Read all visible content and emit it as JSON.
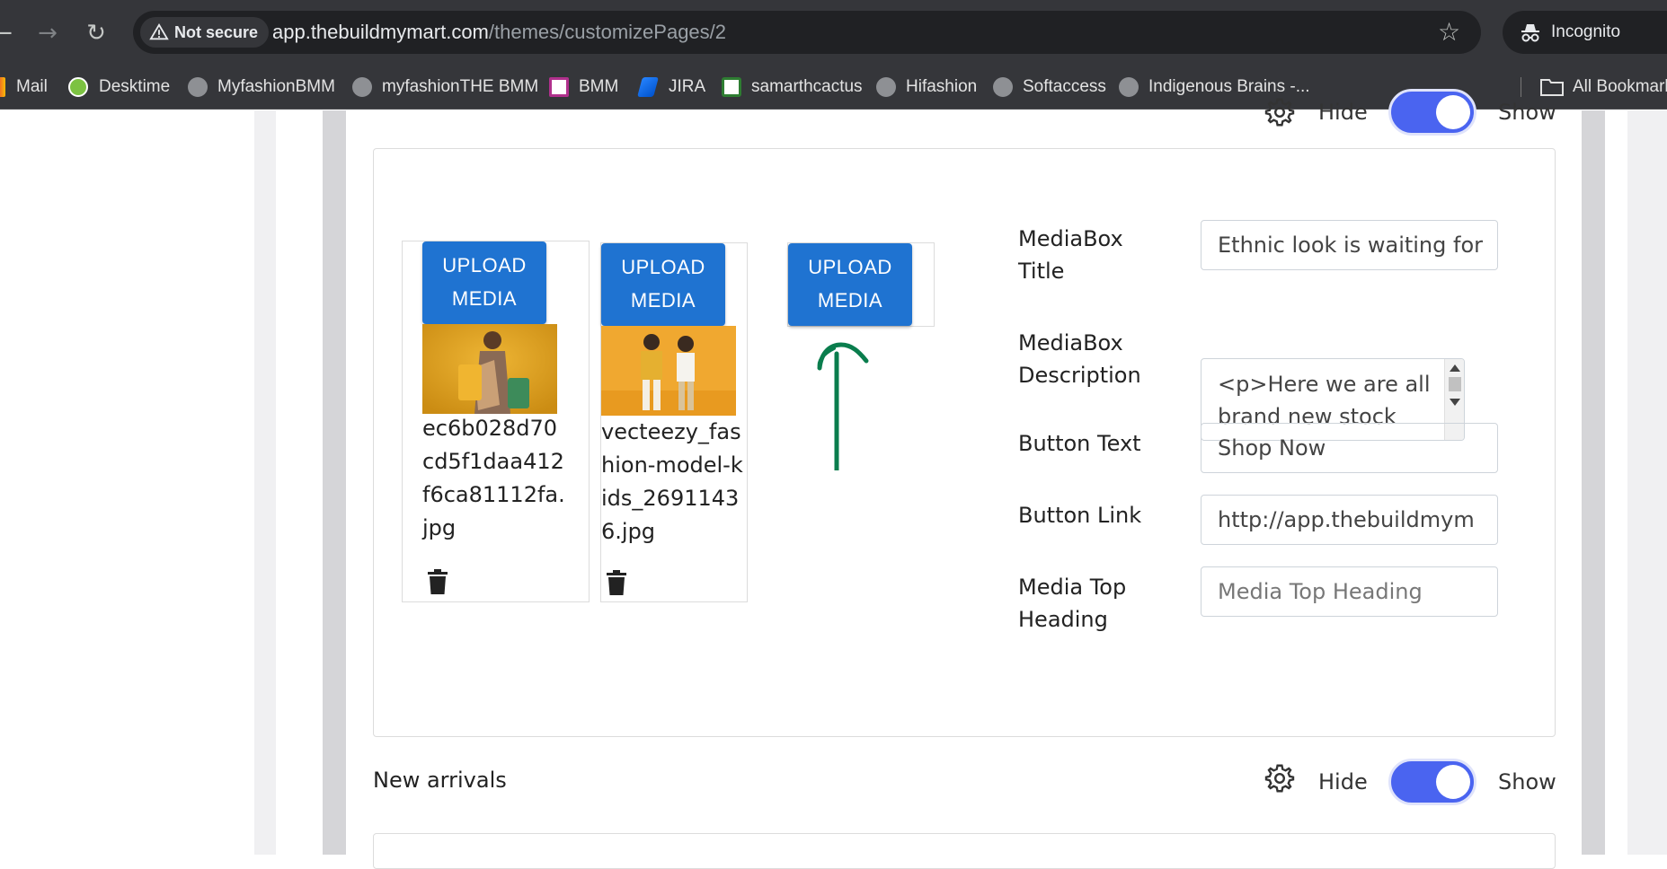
{
  "browser": {
    "security_label": "Not secure",
    "url_host": "app.thebuildmymart.com",
    "url_path": "/themes/customizePages/2",
    "incognito_label": "Incognito",
    "bookmarks": [
      {
        "label": "Mail",
        "icon": "gmail-icon"
      },
      {
        "label": "Desktime",
        "icon": "desktime-icon"
      },
      {
        "label": "MyfashionBMM",
        "icon": "globe-icon"
      },
      {
        "label": "myfashionTHE BMM",
        "icon": "globe-icon"
      },
      {
        "label": "BMM",
        "icon": "bmm-icon"
      },
      {
        "label": "JIRA",
        "icon": "jira-icon"
      },
      {
        "label": "samarthcactus",
        "icon": "cactus-icon"
      },
      {
        "label": "Hifashion",
        "icon": "globe-icon"
      },
      {
        "label": "Softaccess",
        "icon": "globe-icon"
      },
      {
        "label": "Indigenous Brains -...",
        "icon": "globe-icon"
      }
    ],
    "all_bookmarks_label": "All Bookmarks"
  },
  "top_toggle": {
    "hide_label": "Hide",
    "show_label": "Show",
    "state": "show"
  },
  "media": {
    "upload_label_line1": "UPLOAD",
    "upload_label_line2": "MEDIA",
    "items": [
      {
        "filename": "ec6b028d70cd5f1daa412f6ca81112fa.jpg"
      },
      {
        "filename": "vecteezy_fashion-model-kids_26911436.jpg"
      }
    ]
  },
  "form": {
    "title_label": "MediaBox Title",
    "title_value": "Ethnic look is waiting for",
    "description_label": "MediaBox Description",
    "description_value": "<p>Here we are all brand new stock",
    "button_text_label": "Button Text",
    "button_text_value": "Shop Now",
    "button_link_label": "Button Link",
    "button_link_value": "http://app.thebuildmym",
    "top_heading_label": "Media Top Heading",
    "top_heading_placeholder": "Media Top Heading"
  },
  "new_arrivals": {
    "title": "New arrivals",
    "hide_label": "Hide",
    "show_label": "Show",
    "state": "show"
  },
  "colors": {
    "accent": "#1f73d1",
    "toggle": "#4a64f0",
    "annotation": "#0a7d4d"
  }
}
